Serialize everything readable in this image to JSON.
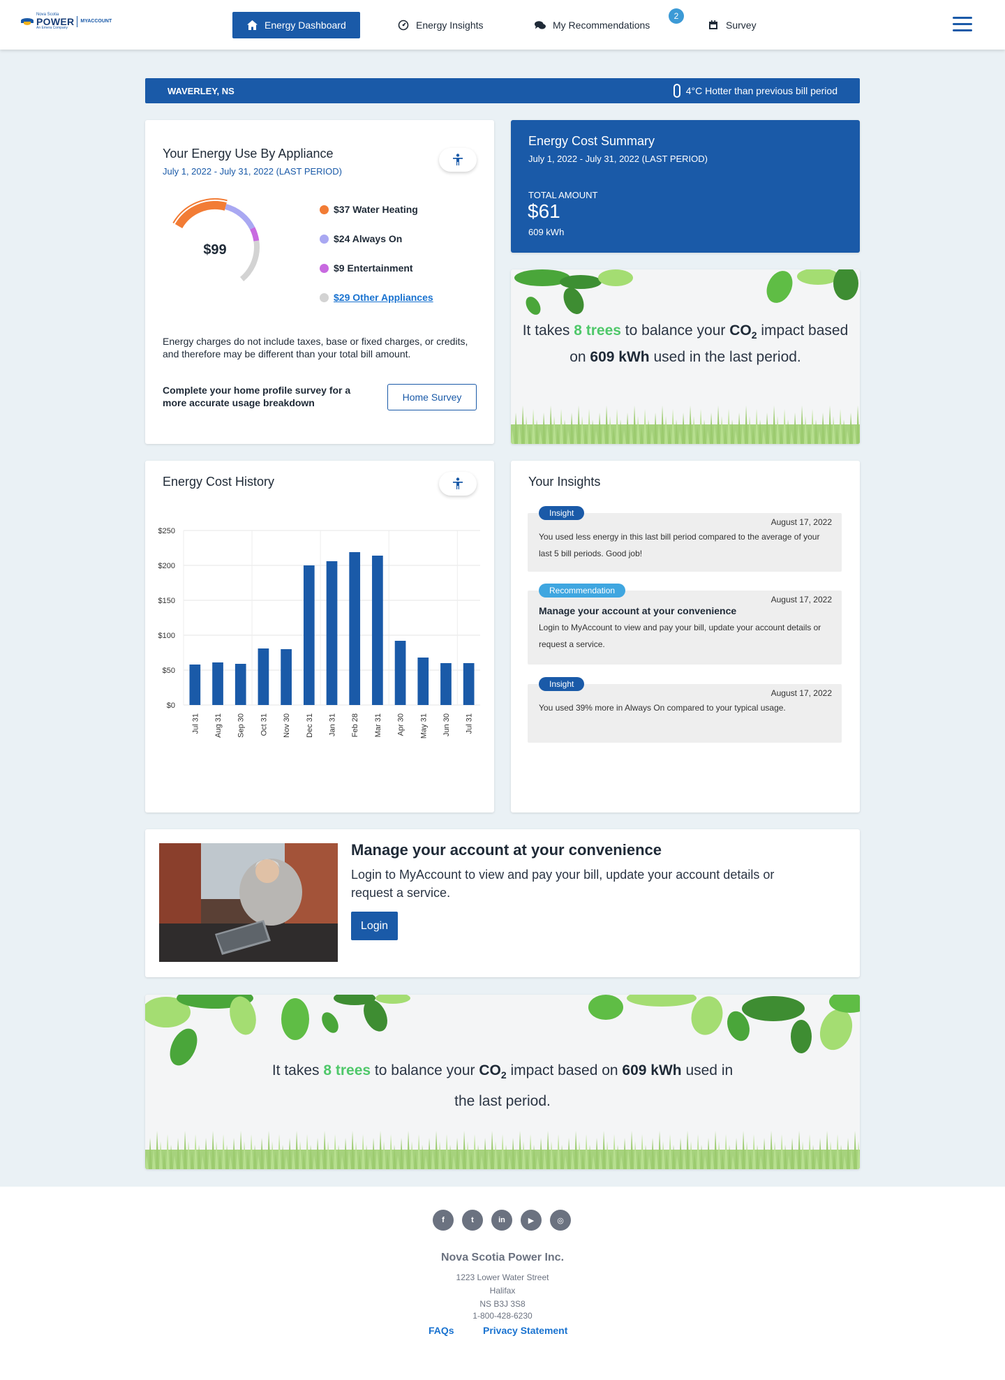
{
  "header": {
    "logo": {
      "small": "Nova Scotia",
      "name": "POWER",
      "tagline": "An Emera Company",
      "product": "MYACCOUNT"
    },
    "nav": [
      {
        "label": "Energy Dashboard",
        "icon": "home-icon",
        "active": true
      },
      {
        "label": "Energy Insights",
        "icon": "gauge-icon"
      },
      {
        "label": "My Recommendations",
        "icon": "chat-icon",
        "badge": "2"
      },
      {
        "label": "Survey",
        "icon": "calendar-icon"
      }
    ]
  },
  "location": {
    "name": "WAVERLEY, NS",
    "temp_note": "4°C Hotter than previous bill period"
  },
  "appliance": {
    "title": "Your Energy Use By Appliance",
    "period": "July 1, 2022 - July 31, 2022 (LAST PERIOD)",
    "total": "$99",
    "items": [
      {
        "label": "$37 Water Heating",
        "value": 37,
        "color": "#f27c35"
      },
      {
        "label": "$24 Always On",
        "value": 24,
        "color": "#a9a8f2"
      },
      {
        "label": "$9 Entertainment",
        "value": 9,
        "color": "#c86ae0"
      },
      {
        "label": "$29 Other Appliances",
        "value": 29,
        "color": "#d3d3d3",
        "link": true
      }
    ],
    "note": "Energy charges do not include taxes, base or fixed charges, or credits, and therefore may be different than your total bill amount.",
    "survey_prompt": "Complete your home profile survey for a more accurate usage breakdown",
    "survey_button": "Home Survey"
  },
  "summary": {
    "title": "Energy Cost Summary",
    "period": "July 1, 2022 - July 31, 2022 (LAST PERIOD)",
    "total_label": "TOTAL AMOUNT",
    "total": "$61",
    "kwh": "609 kWh"
  },
  "trees": {
    "p1": "It takes ",
    "count": "8 trees",
    "p2": " to balance your ",
    "co2": "CO",
    "sub": "2",
    "p3": " impact based on ",
    "kwh": "609 kWh",
    "p4": " used in the last period."
  },
  "history": {
    "title": "Energy Cost History"
  },
  "chart_data": {
    "type": "bar",
    "categories": [
      "Jul 31",
      "Aug 31",
      "Sep 30",
      "Oct 31",
      "Nov 30",
      "Dec 31",
      "Jan 31",
      "Feb 28",
      "Mar 31",
      "Apr 30",
      "May 31",
      "Jun 30",
      "Jul 31"
    ],
    "values": [
      58,
      61,
      59,
      81,
      80,
      200,
      206,
      219,
      214,
      92,
      68,
      60,
      60
    ],
    "ylim": [
      0,
      250
    ],
    "yticks": [
      "$0",
      "$50",
      "$100",
      "$150",
      "$200",
      "$250"
    ],
    "color": "#1a5aa8",
    "grid": true
  },
  "insights": {
    "title": "Your Insights",
    "items": [
      {
        "tag": "Insight",
        "date": "August 17, 2022",
        "text": "You used less energy in this last bill period compared to the average of your last 5 bill periods. Good job!"
      },
      {
        "tag": "Recommendation",
        "date": "August 17, 2022",
        "heading": "Manage your account at your convenience",
        "text": "Login to MyAccount to view and pay your bill, update your account details or request a service."
      },
      {
        "tag": "Insight",
        "date": "August 17, 2022",
        "text": "You used 39% more in Always On compared to your typical usage."
      }
    ]
  },
  "promo": {
    "title": "Manage your account at your convenience",
    "text": "Login to MyAccount to view and pay your bill, update your account details or request a service.",
    "button": "Login"
  },
  "footer": {
    "social": [
      "f",
      "t",
      "in",
      "▶",
      "◎"
    ],
    "company": "Nova Scotia Power Inc.",
    "address": [
      "1223 Lower Water Street",
      "Halifax",
      "NS B3J 3S8",
      "1-800-428-6230"
    ],
    "links": [
      "FAQs",
      "Privacy Statement"
    ]
  }
}
